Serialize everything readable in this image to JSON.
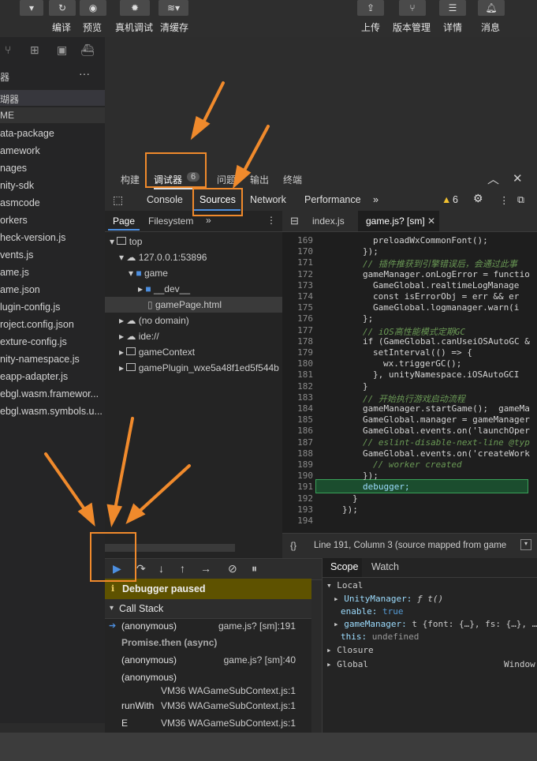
{
  "toolbar": {
    "compile": "编译",
    "preview": "预览",
    "device_debug": "真机调试",
    "clear_cache": "清缓存",
    "upload": "上传",
    "version_mgmt": "版本管理",
    "details": "详情",
    "messages": "消息"
  },
  "sidebar": {
    "title": "器",
    "section": "瑚器",
    "section2": "ME",
    "files": [
      "ata-package",
      "amework",
      "nages",
      "nity-sdk",
      "asmcode",
      "orkers",
      "heck-version.js",
      "vents.js",
      "ame.js",
      "ame.json",
      "lugin-config.js",
      "roject.config.json",
      "exture-config.js",
      "nity-namespace.js",
      "eapp-adapter.js",
      "ebgl.wasm.framewor...",
      "ebgl.wasm.symbols.u..."
    ]
  },
  "devtools": {
    "top_tabs": [
      "构建",
      "调试器",
      "问题",
      "输出",
      "终端"
    ],
    "debugger_badge": "6",
    "tabs": [
      "Console",
      "Sources",
      "Network",
      "Performance"
    ],
    "warning_count": "6"
  },
  "navigator": {
    "tabs": [
      "Page",
      "Filesystem"
    ],
    "tree": [
      "top",
      "127.0.0.1:53896",
      "game",
      "__dev__",
      "gamePage.html",
      "(no domain)",
      "ide://",
      "gameContext",
      "gamePlugin_wxe5a48f1ed5f544b"
    ]
  },
  "editor": {
    "files": [
      "index.js",
      "game.js? [sm]"
    ],
    "status": "Line 191, Column 3  (source mapped from game",
    "lines": [
      {
        "n": "169",
        "t": "preloadWxCommonFont();"
      },
      {
        "n": "170",
        "t": "});"
      },
      {
        "n": "171",
        "t": "// 插件推获到引擎错误后，会通过此事"
      },
      {
        "n": "172",
        "t": "gameManager.onLogError = functio"
      },
      {
        "n": "173",
        "t": "GameGlobal.realtimeLogManage"
      },
      {
        "n": "174",
        "t": "const isErrorObj = err && er"
      },
      {
        "n": "175",
        "t": "GameGlobal.logmanager.warn(i"
      },
      {
        "n": "176",
        "t": "};"
      },
      {
        "n": "177",
        "t": "// iOS高性能模式定期GC"
      },
      {
        "n": "178",
        "t": "if (GameGlobal.canUseiOSAutoGC &"
      },
      {
        "n": "179",
        "t": "setInterval(() => {"
      },
      {
        "n": "180",
        "t": "wx.triggerGC();"
      },
      {
        "n": "181",
        "t": "}, unityNamespace.iOSAutoGCI"
      },
      {
        "n": "182",
        "t": "}"
      },
      {
        "n": "183",
        "t": "// 开始执行游戏启动流程"
      },
      {
        "n": "184",
        "t": "gameManager.startGame();  gameMa"
      },
      {
        "n": "185",
        "t": "GameGlobal.manager = gameManager"
      },
      {
        "n": "186",
        "t": "GameGlobal.events.on('launchOper"
      },
      {
        "n": "187",
        "t": "// eslint-disable-next-line @typ"
      },
      {
        "n": "188",
        "t": "GameGlobal.events.on('createWork"
      },
      {
        "n": "189",
        "t": "// worker created"
      },
      {
        "n": "190",
        "t": "});"
      },
      {
        "n": "191",
        "t": "debugger;"
      },
      {
        "n": "192",
        "t": "}"
      },
      {
        "n": "193",
        "t": "});"
      },
      {
        "n": "194",
        "t": ""
      }
    ]
  },
  "debugger": {
    "paused": "Debugger paused",
    "call_stack": "Call Stack",
    "frames": [
      {
        "fn": "(anonymous)",
        "loc": "game.js? [sm]:191"
      },
      {
        "fn": "Promise.then (async)",
        "loc": ""
      },
      {
        "fn": "(anonymous)",
        "loc": "game.js? [sm]:40"
      },
      {
        "fn": "(anonymous)",
        "loc": "VM36 WAGameSubContext.js:1"
      },
      {
        "fn": "runWith",
        "loc": "VM36 WAGameSubContext.js:1"
      },
      {
        "fn": "E",
        "loc": "VM36 WAGameSubContext.js:1"
      }
    ]
  },
  "scope": {
    "tabs": [
      "Scope",
      "Watch"
    ],
    "local": "Local",
    "unity_manager_key": "UnityManager:",
    "unity_manager_val": "ƒ t()",
    "enable_key": "enable:",
    "enable_val": "true",
    "game_manager_key": "gameManager:",
    "game_manager_val": "t {font: {…}, fs: {…}, …",
    "this_key": "this:",
    "this_val": "undefined",
    "closure": "Closure",
    "global": "Global",
    "global_val": "Window"
  },
  "colors": {
    "accent": "#f08a2c",
    "highlight_line": "#1b4d2e",
    "paused_bg": "#5e5200"
  }
}
